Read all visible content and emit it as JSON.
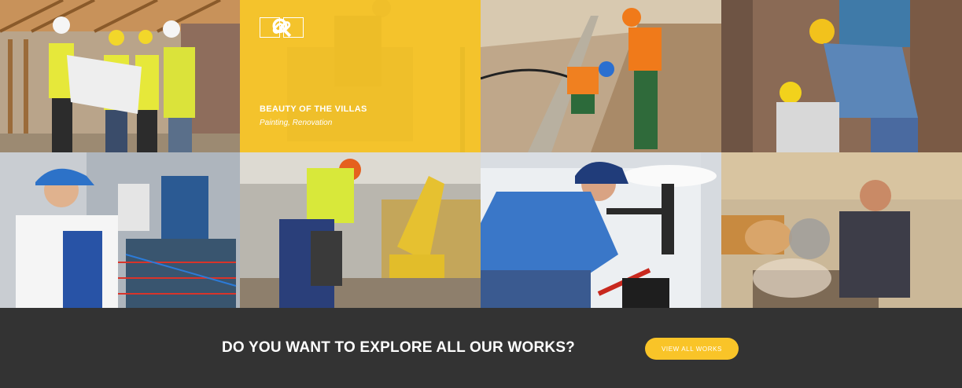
{
  "gallery": {
    "overlay": {
      "title": "BEAUTY OF THE VILLAS",
      "subtitle": "Painting, Renovation",
      "icons": [
        "search-icon",
        "link-icon"
      ]
    }
  },
  "cta": {
    "text": "DO YOU WANT TO EXPLORE ALL OUR WORKS?",
    "button_label": "VIEW ALL WORKS"
  },
  "colors": {
    "accent": "#f9c428",
    "footer_bg": "#333333"
  }
}
